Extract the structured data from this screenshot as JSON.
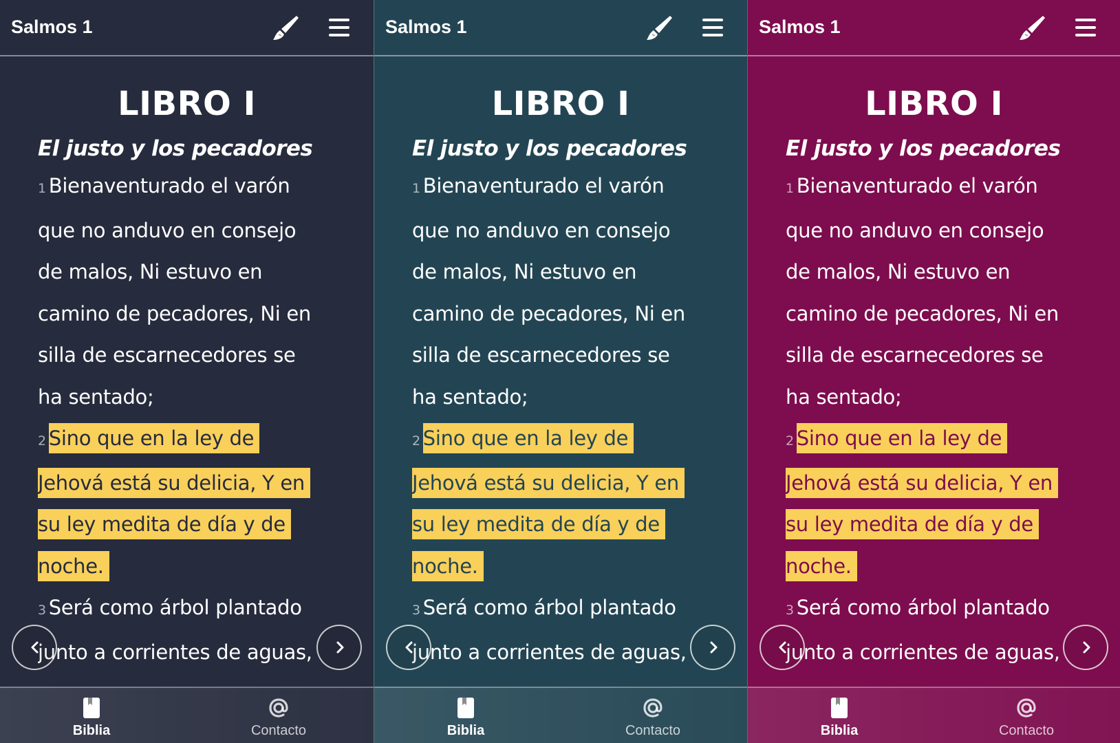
{
  "panels": [
    {
      "theme": "dark-navy",
      "background": "#262b3d",
      "highlight_text_color": "#262b3d",
      "title": "Salmos 1",
      "book": "LIBRO I",
      "heading": "El justo y los pecadores",
      "verses": [
        {
          "num": "1",
          "text": "Bienaventurado el varón que no anduvo en consejo de malos, Ni estuvo en camino de pecadores, Ni en silla de escarnecedores se ha sentado;"
        },
        {
          "num": "2",
          "text": "Sino que en la ley de Jehová está su delicia, Y en su ley medita de día y de noche."
        },
        {
          "num": "3",
          "text": "Será como árbol plantado junto a corrientes de aguas,"
        }
      ],
      "nav": {
        "prev_icon": "chevron-left-icon",
        "next_icon": "chevron-right-icon"
      },
      "tabs": [
        {
          "label": "Biblia",
          "icon": "book-icon"
        },
        {
          "label": "Contacto",
          "icon": "at-sign-icon"
        }
      ]
    },
    {
      "theme": "dark-teal",
      "background": "#234553",
      "highlight_text_color": "#234553",
      "title": "Salmos 1",
      "book": "LIBRO I",
      "heading": "El justo y los pecadores",
      "verses": [
        {
          "num": "1",
          "text": "Bienaventurado el varón que no anduvo en consejo de malos, Ni estuvo en camino de pecadores, Ni en silla de escarnecedores se ha sentado;"
        },
        {
          "num": "2",
          "text": "Sino que en la ley de Jehová está su delicia, Y en su ley medita de día y de noche."
        },
        {
          "num": "3",
          "text": "Será como árbol plantado junto a corrientes de aguas,"
        }
      ],
      "nav": {
        "prev_icon": "chevron-left-icon",
        "next_icon": "chevron-right-icon"
      },
      "tabs": [
        {
          "label": "Biblia",
          "icon": "book-icon"
        },
        {
          "label": "Contacto",
          "icon": "at-sign-icon"
        }
      ]
    },
    {
      "theme": "magenta",
      "background": "#7d0d4e",
      "highlight_text_color": "#7d0d4e",
      "title": "Salmos 1",
      "book": "LIBRO I",
      "heading": "El justo y los pecadores",
      "verses": [
        {
          "num": "1",
          "text": "Bienaventurado el varón que no anduvo en consejo de malos, Ni estuvo en camino de pecadores, Ni en silla de escarnecedores se ha sentado;"
        },
        {
          "num": "2",
          "text": "Sino que en la ley de Jehová está su delicia, Y en su ley medita de día y de noche."
        },
        {
          "num": "3",
          "text": "Será como árbol plantado junto a corrientes de aguas,"
        }
      ],
      "nav": {
        "prev_icon": "chevron-left-icon",
        "next_icon": "chevron-right-icon"
      },
      "tabs": [
        {
          "label": "Biblia",
          "icon": "book-icon"
        },
        {
          "label": "Contacto",
          "icon": "at-sign-icon"
        }
      ]
    }
  ],
  "highlight_color": "#f9d05a"
}
